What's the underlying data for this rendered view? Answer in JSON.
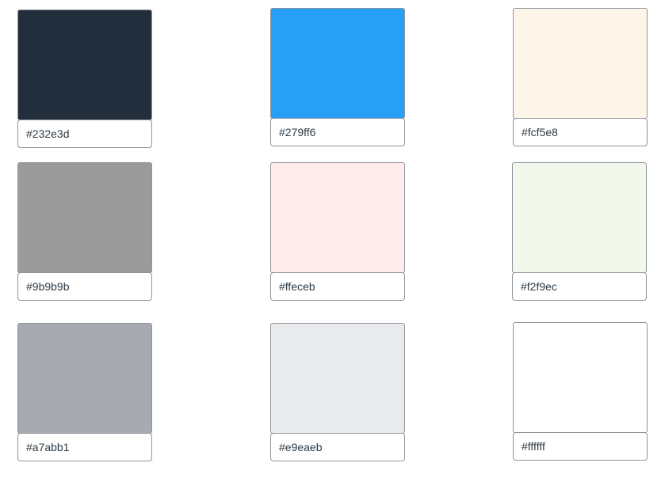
{
  "swatches": [
    {
      "hex": "#232e3d"
    },
    {
      "hex": "#279ff6"
    },
    {
      "hex": "#fcf5e8"
    },
    {
      "hex": "#9b9b9b"
    },
    {
      "hex": "#ffeceb"
    },
    {
      "hex": "#f2f9ec"
    },
    {
      "hex": "#a7abb1"
    },
    {
      "hex": "#e9eaeb"
    },
    {
      "hex": "#ffffff"
    }
  ]
}
